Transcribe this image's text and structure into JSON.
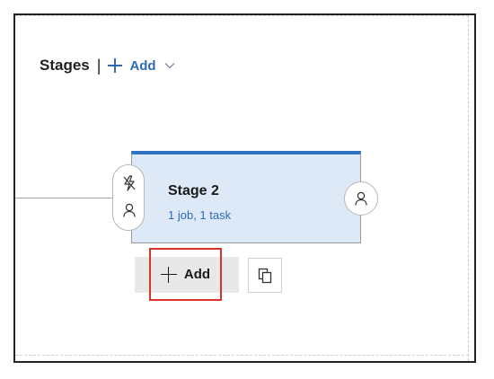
{
  "header": {
    "title": "Stages",
    "separator": "|",
    "add_label": "Add",
    "add_icon": "plus-icon",
    "dropdown_icon": "chevron-down-icon"
  },
  "stage": {
    "name": "Stage 2",
    "summary": "1 job, 1 task",
    "pre_deployment_icons": [
      "lightning-icon",
      "person-icon"
    ],
    "post_deployment_icon": "person-icon",
    "accent_color": "#2f72c4",
    "card_color": "#dde9f6"
  },
  "actions": {
    "add_label": "Add",
    "clone_icon": "clone-icon",
    "highlight_color": "#d9342b"
  }
}
